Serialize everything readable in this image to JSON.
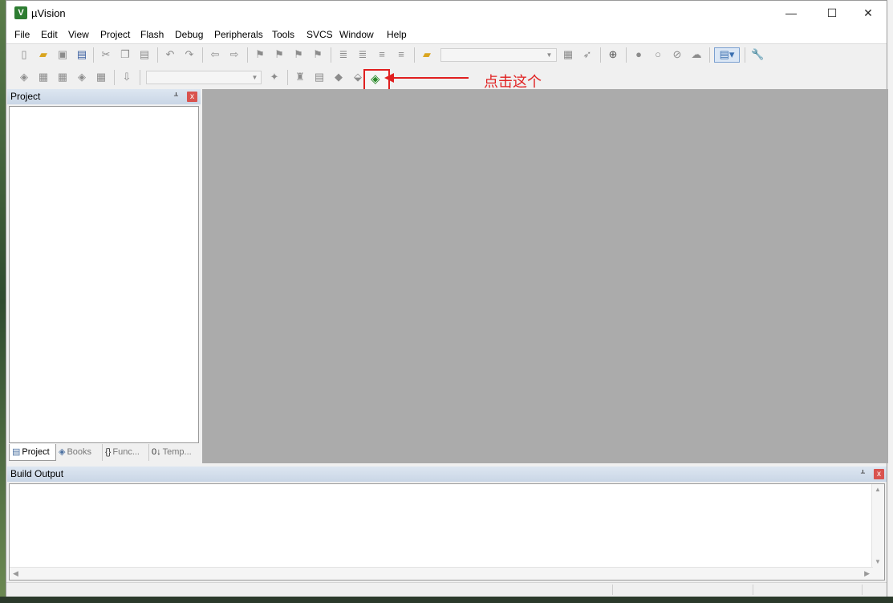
{
  "window": {
    "title": "µVision",
    "app_icon": "V",
    "minimize_glyph": "—",
    "maximize_glyph": "☐",
    "close_glyph": "✕"
  },
  "menu": [
    "File",
    "Edit",
    "View",
    "Project",
    "Flash",
    "Debug",
    "Peripherals",
    "Tools",
    "SVCS",
    "Window",
    "Help"
  ],
  "toolbar1": {
    "icons": [
      "new-file-icon",
      "open-file-icon",
      "save-icon",
      "save-all-icon",
      "cut-icon",
      "copy-icon",
      "paste-icon",
      "undo-icon",
      "redo-icon",
      "navigate-back-icon",
      "navigate-forward-icon",
      "bookmark-icon",
      "prev-bookmark-icon",
      "next-bookmark-icon",
      "clear-bookmarks-icon",
      "indent-icon",
      "unindent-icon",
      "comment-icon",
      "uncomment-icon",
      "find-in-files-icon",
      "find-icon",
      "incremental-find-icon",
      "zoom-icon",
      "debug-session-icon",
      "breakpoint-icon",
      "disable-breakpoint-icon",
      "kill-breakpoints-icon",
      "window-layout-icon",
      "configure-icon"
    ],
    "search_combo_value": ""
  },
  "toolbar2": {
    "icons": [
      "translate-icon",
      "build-icon",
      "rebuild-icon",
      "batch-build-icon",
      "stop-build-icon",
      "download-icon",
      "target-options-wand-icon",
      "manage-components-icon",
      "select-packs-icon",
      "pack-installer-icon",
      "install-icon"
    ],
    "target_combo_value": ""
  },
  "highlighted_button": {
    "icon": "pack-installer-icon"
  },
  "annotation": {
    "text": "点击这个",
    "color": "#e02020"
  },
  "project_panel": {
    "title": "Project",
    "pin": "ᚆ",
    "close": "x",
    "tabs": [
      {
        "icon": "▤",
        "label": "Project"
      },
      {
        "icon": "◈",
        "label": "Books"
      },
      {
        "icon": "{}",
        "label": "Func..."
      },
      {
        "icon": "0↓",
        "label": "Temp..."
      }
    ]
  },
  "build_panel": {
    "title": "Build Output",
    "pin": "ᚆ",
    "close": "x"
  },
  "colors": {
    "editor_background": "#ababab",
    "panel_header": "#c9d6e6",
    "accent_red": "#e02020"
  }
}
